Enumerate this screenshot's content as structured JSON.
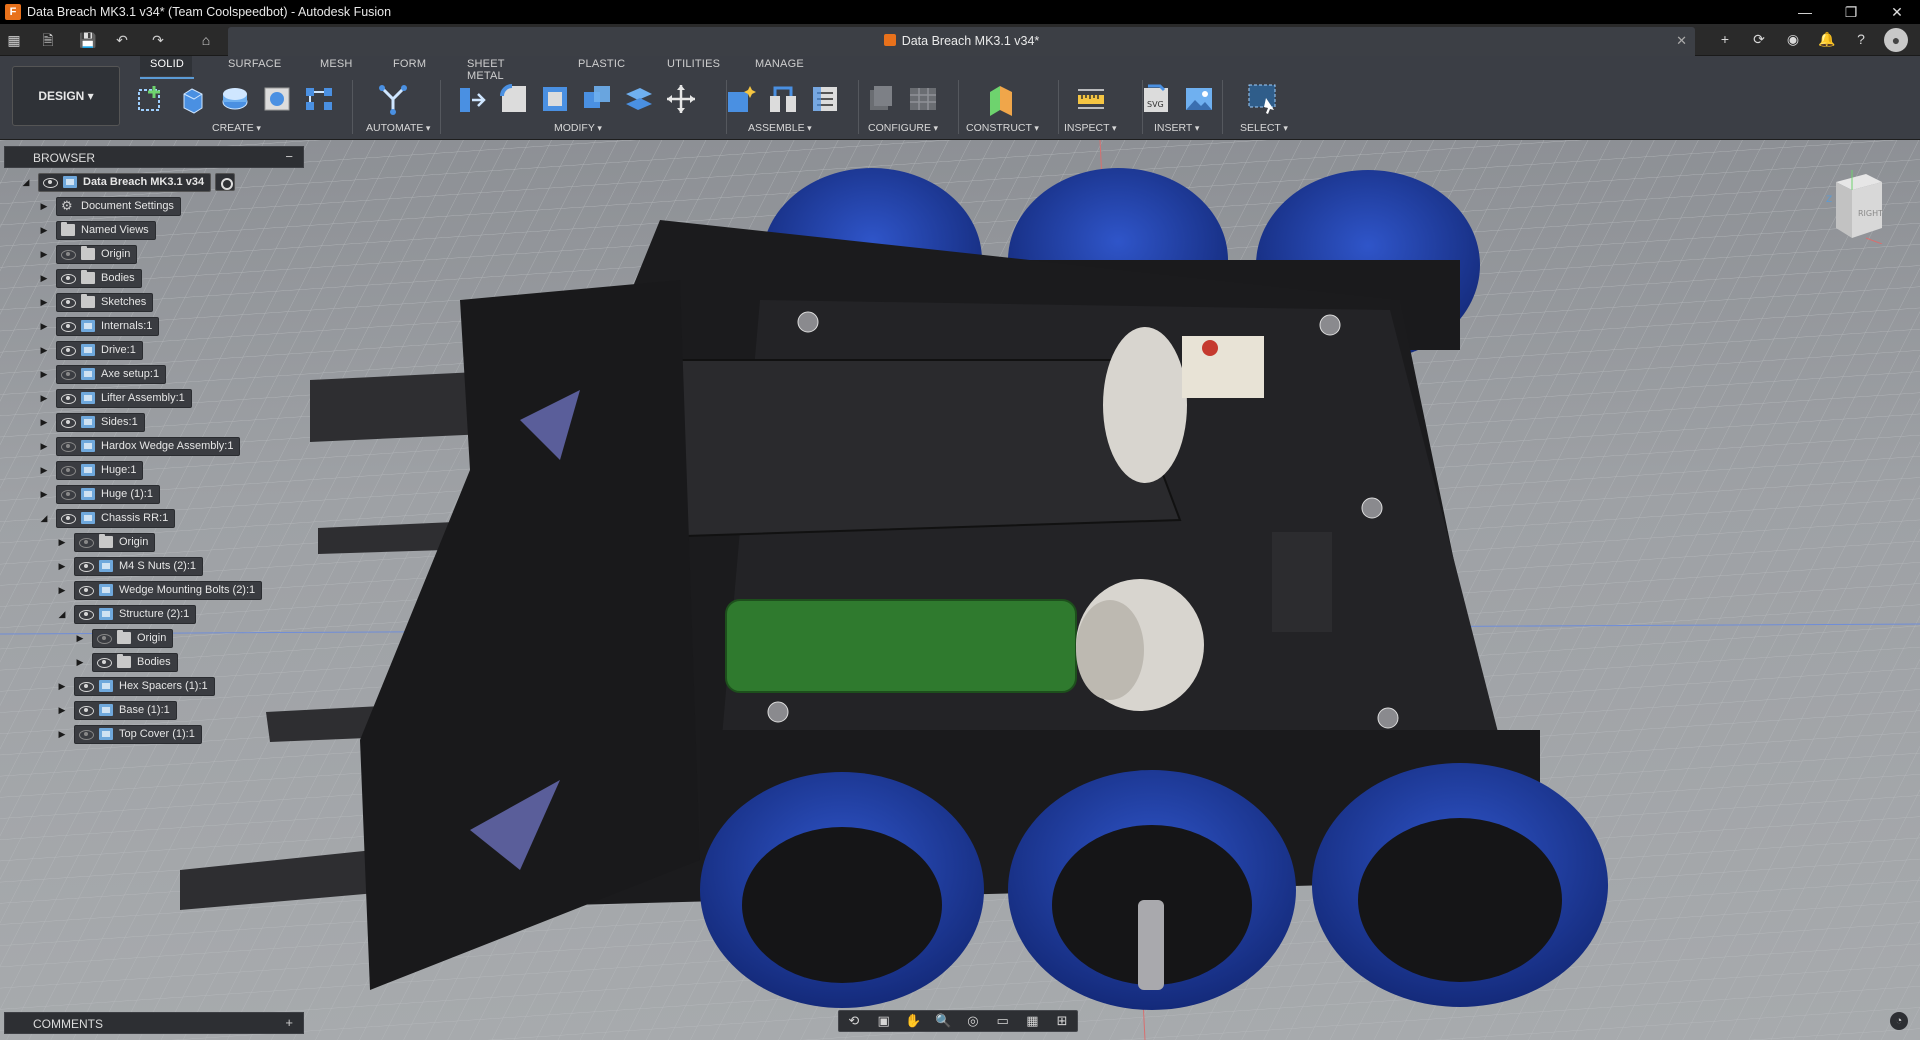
{
  "window": {
    "title": "Data Breach MK3.1 v34* (Team Coolspeedbot) - Autodesk Fusion",
    "logo_letter": "F"
  },
  "document_tab": {
    "title": "Data Breach MK3.1 v34*"
  },
  "workspace": {
    "label": "DESIGN ▾"
  },
  "ribbon_tabs": [
    "SOLID",
    "SURFACE",
    "MESH",
    "FORM",
    "SHEET METAL",
    "PLASTIC",
    "UTILITIES",
    "MANAGE"
  ],
  "ribbon_groups": [
    "CREATE",
    "AUTOMATE",
    "MODIFY",
    "ASSEMBLE",
    "CONFIGURE",
    "CONSTRUCT",
    "INSPECT",
    "INSERT",
    "SELECT"
  ],
  "browser": {
    "header": "BROWSER",
    "root": "Data Breach MK3.1 v34",
    "items": [
      {
        "label": "Document Settings",
        "icon": "gear-icon"
      },
      {
        "label": "Named Views",
        "icon": "folder-icon"
      },
      {
        "label": "Origin",
        "icon": "folder-icon"
      },
      {
        "label": "Bodies",
        "icon": "folder-icon"
      },
      {
        "label": "Sketches",
        "icon": "folder-icon"
      },
      {
        "label": "Internals:1",
        "icon": "component-icon"
      },
      {
        "label": "Drive:1",
        "icon": "component-icon"
      },
      {
        "label": "Axe setup:1",
        "icon": "component-icon"
      },
      {
        "label": "Lifter Assembly:1",
        "icon": "component-icon"
      },
      {
        "label": "Sides:1",
        "icon": "component-icon"
      },
      {
        "label": "Hardox Wedge Assembly:1",
        "icon": "component-icon"
      },
      {
        "label": "Huge:1",
        "icon": "component-icon"
      },
      {
        "label": "Huge (1):1",
        "icon": "component-icon"
      },
      {
        "label": "Chassis RR:1",
        "icon": "component-icon"
      },
      {
        "label": "Origin",
        "icon": "folder-icon"
      },
      {
        "label": "M4 S Nuts (2):1",
        "icon": "component-icon"
      },
      {
        "label": "Wedge Mounting Bolts (2):1",
        "icon": "component-icon"
      },
      {
        "label": "Structure (2):1",
        "icon": "component-icon"
      },
      {
        "label": "Origin",
        "icon": "folder-icon"
      },
      {
        "label": "Bodies",
        "icon": "folder-icon"
      },
      {
        "label": "Hex Spacers (1):1",
        "icon": "component-icon"
      },
      {
        "label": "Base (1):1",
        "icon": "component-icon"
      },
      {
        "label": "Top Cover (1):1",
        "icon": "component-icon"
      }
    ]
  },
  "comments": {
    "header": "COMMENTS"
  },
  "viewcube": {
    "face": "RIGHT",
    "axis_label": "Z"
  },
  "colors": {
    "accent": "#5b9bd5",
    "brand": "#e8711b",
    "wheel_blue": "#1d3a9e",
    "chassis": "#1b1b1d",
    "battery_green": "#2f7a2e"
  }
}
